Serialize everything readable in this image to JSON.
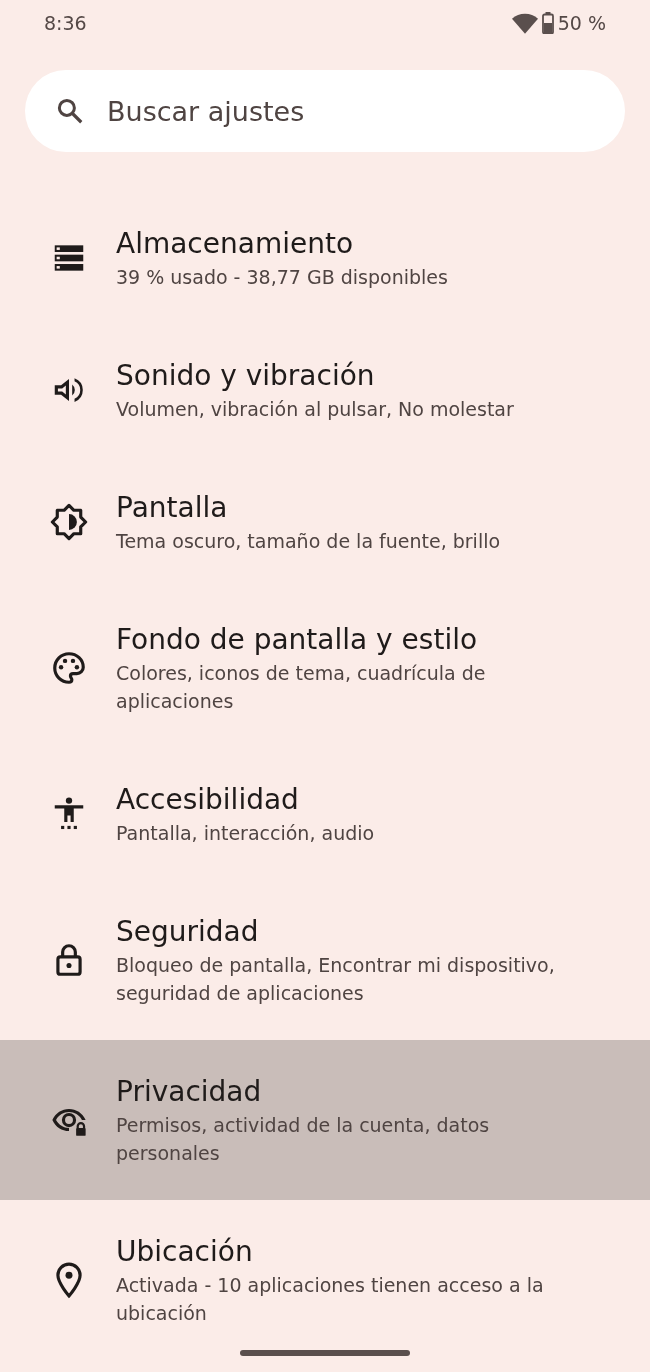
{
  "status_bar": {
    "time": "8:36",
    "battery": "50 %"
  },
  "search": {
    "placeholder": "Buscar ajustes"
  },
  "items": [
    {
      "title": "Almacenamiento",
      "subtitle": "39 % usado - 38,77 GB disponibles",
      "selected": false
    },
    {
      "title": "Sonido y vibración",
      "subtitle": "Volumen, vibración al pulsar, No molestar",
      "selected": false
    },
    {
      "title": "Pantalla",
      "subtitle": "Tema oscuro, tamaño de la fuente, brillo",
      "selected": false
    },
    {
      "title": "Fondo de pantalla y estilo",
      "subtitle": "Colores, iconos de tema, cuadrícula de aplicaciones",
      "selected": false
    },
    {
      "title": "Accesibilidad",
      "subtitle": "Pantalla, interacción, audio",
      "selected": false
    },
    {
      "title": "Seguridad",
      "subtitle": "Bloqueo de pantalla, Encontrar mi dispositivo, seguridad de aplicaciones",
      "selected": false
    },
    {
      "title": "Privacidad",
      "subtitle": "Permisos, actividad de la cuenta, datos personales",
      "selected": true
    },
    {
      "title": "Ubicación",
      "subtitle": "Activada - 10 aplicaciones tienen acceso a la ubicación",
      "selected": false
    }
  ]
}
